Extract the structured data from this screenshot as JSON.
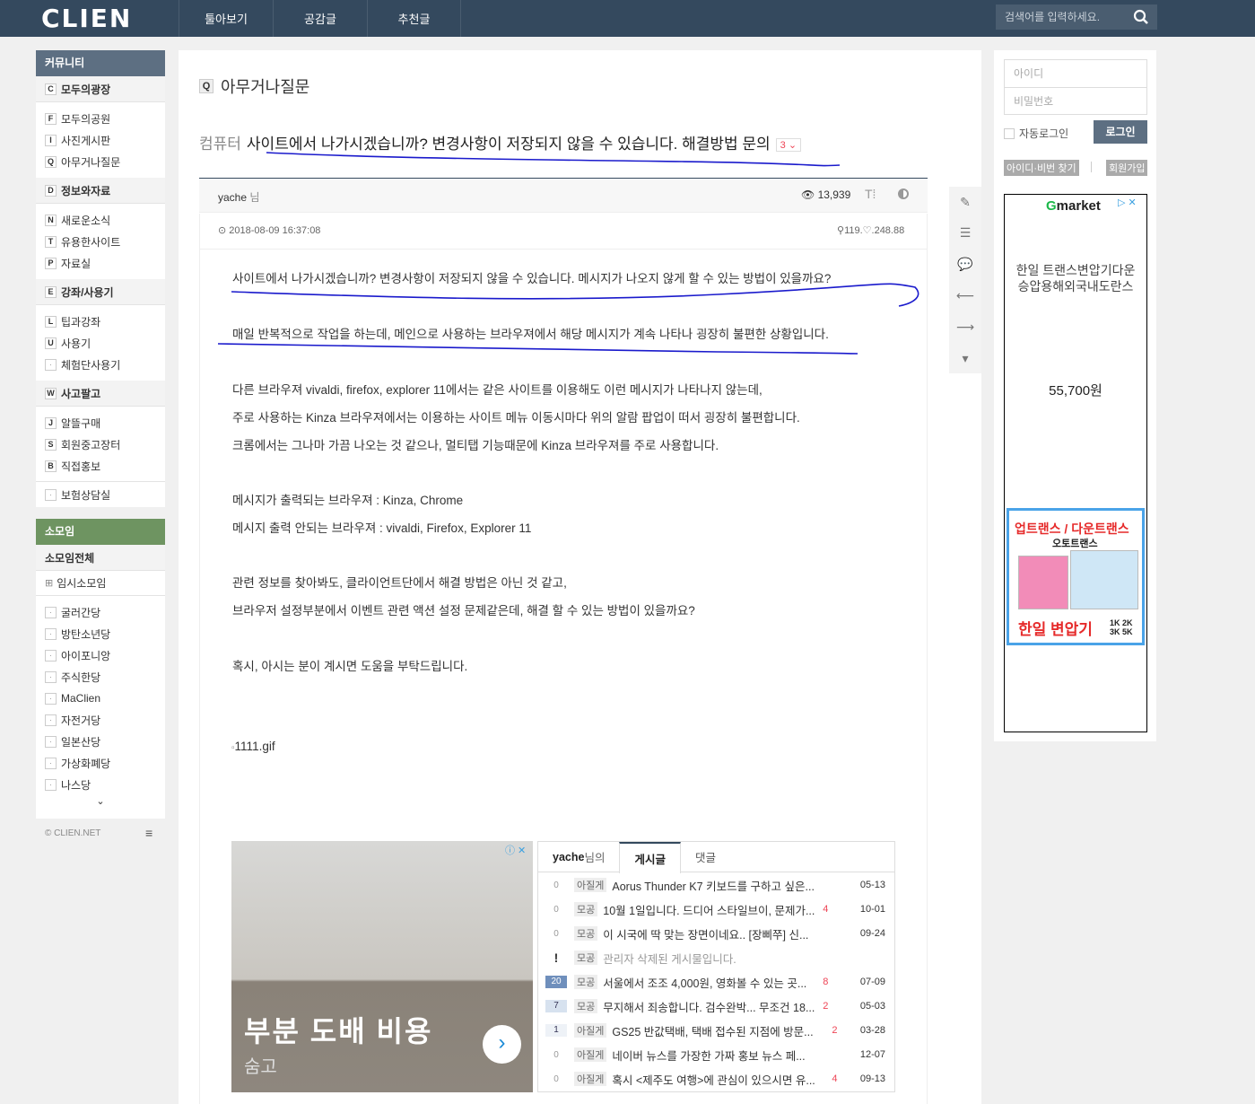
{
  "header": {
    "logo": "CLIEN",
    "nav": [
      "툴아보기",
      "공감글",
      "추천글"
    ],
    "search_placeholder": "검색어를 입력하세요."
  },
  "sidebar": {
    "community_title": "커뮤니티",
    "groups": [
      {
        "badge": "C",
        "label": "모두의광장",
        "items": [
          {
            "badge": "F",
            "label": "모두의공원"
          },
          {
            "badge": "I",
            "label": "사진게시판"
          },
          {
            "badge": "Q",
            "label": "아무거나질문"
          }
        ]
      },
      {
        "badge": "D",
        "label": "정보와자료",
        "items": [
          {
            "badge": "N",
            "label": "새로운소식"
          },
          {
            "badge": "T",
            "label": "유용한사이트"
          },
          {
            "badge": "P",
            "label": "자료실"
          }
        ]
      },
      {
        "badge": "E",
        "label": "강좌/사용기",
        "items": [
          {
            "badge": "L",
            "label": "팁과강좌"
          },
          {
            "badge": "U",
            "label": "사용기"
          },
          {
            "badge": "·",
            "label": "체험단사용기"
          }
        ]
      },
      {
        "badge": "W",
        "label": "사고팔고",
        "items": [
          {
            "badge": "J",
            "label": "알뜰구매"
          },
          {
            "badge": "S",
            "label": "회원중고장터"
          },
          {
            "badge": "B",
            "label": "직접홍보"
          }
        ]
      }
    ],
    "insurance": "보험상담실",
    "somoim_title": "소모임",
    "somoim_all": "소모임전체",
    "temp_somoim": "임시소모임",
    "somoim_items": [
      "굴러간당",
      "방탄소년당",
      "아이포니앙",
      "주식한당",
      "MaClien",
      "자전거당",
      "일본산당",
      "가상화폐당",
      "나스당"
    ],
    "footer": "© CLIEN.NET"
  },
  "board": {
    "badge": "Q",
    "title": "아무거나질문"
  },
  "post": {
    "category": "컴퓨터",
    "title": "사이트에서 나가시겠습니까? 변경사항이 저장되지 않을 수 있습니다. 해결방법 문의",
    "comment_count": "3",
    "author": "yache",
    "author_suffix": " 님",
    "views": "13,939",
    "font_tool": "T⁞",
    "date": "2018-08-09 16:37:08",
    "ip": "119.♡.248.88",
    "paragraphs": [
      "사이트에서 나가시겠습니까? 변경사항이 저장되지 않을 수 있습니다. 메시지가 나오지 않게 할 수 있는 방법이 있을까요?",
      "매일 반복적으로 작업을 하는데, 메인으로 사용하는 브라우져에서 해당 메시지가 계속 나타나 굉장히 불편한 상황입니다.",
      "다른 브라우져 vivaldi, firefox, explorer 11에서는 같은 사이트를 이용해도 이런 메시지가 나타나지 않는데,",
      "주로 사용하는 Kinza 브라우져에서는 이용하는 사이트 메뉴 이동시마다 위의 알람 팝업이 떠서 굉장히 불편합니다.",
      "크롬에서는 그나마 가끔 나오는 것 같으나, 멀티탭 기능때문에 Kinza 브라우져를 주로 사용합니다.",
      "메시지가 출력되는 브라우져 : Kinza, Chrome",
      "메시지 출력 안되는 브라우져 : vivaldi, Firefox, Explorer 11",
      "관련 정보를 찾아봐도, 클라이언트단에서 해결 방법은 아닌 것 같고,",
      "브라우저 설정부분에서 이벤트 관련 액션 설정 문제같은데, 해결 할 수 있는 방법이 있을까요?",
      "혹시, 아시는 분이 계시면 도움을 부탁드립니다."
    ],
    "image_alt": "1111.gif"
  },
  "ad_left": {
    "headline": "부분 도배 비용",
    "brand": "숨고"
  },
  "user_posts": {
    "user": "yache",
    "user_suffix": " 님의",
    "tabs": [
      "게시글",
      "댓글"
    ],
    "rows": [
      {
        "num": "0",
        "tag": "아질게",
        "title": "Aorus Thunder K7 키보드를 구하고 싶은...",
        "comments": "",
        "date": "05-13"
      },
      {
        "num": "0",
        "tag": "모공",
        "title": "10월 1일입니다. 드디어 스타일브이, 문제가...",
        "comments": "4",
        "date": "10-01"
      },
      {
        "num": "0",
        "tag": "모공",
        "title": "이 시국에 딱 맞는 장면이네요.. [장삐쭈] 신...",
        "comments": "",
        "date": "09-24"
      },
      {
        "num": "!",
        "tag": "모공",
        "title": "관리자 삭제된 게시물입니다.",
        "comments": "",
        "date": ""
      },
      {
        "num": "20",
        "tag": "모공",
        "title": "서울에서 조조 4,000원, 영화볼 수 있는 곳...",
        "comments": "8",
        "date": "07-09"
      },
      {
        "num": "7",
        "tag": "모공",
        "title": "무지해서 죄송합니다. 검수완박... 무조건 18...",
        "comments": "2",
        "date": "05-03"
      },
      {
        "num": "1",
        "tag": "아질게",
        "title": "GS25 반값택배, 택배 접수된 지점에 방문...",
        "comments": "2",
        "date": "03-28"
      },
      {
        "num": "0",
        "tag": "아질게",
        "title": "네이버 뉴스를 가장한 가짜 홍보 뉴스 페...",
        "comments": "",
        "date": "12-07"
      },
      {
        "num": "0",
        "tag": "아질게",
        "title": "혹시 <제주도 여행>에 관심이 있으시면 유...",
        "comments": "4",
        "date": "09-13"
      }
    ]
  },
  "login": {
    "id_placeholder": "아이디",
    "pw_placeholder": "비밀번호",
    "auto_login": "자동로그인",
    "login_button": "로그인",
    "find": "아이디·비번 찾기",
    "join": "회원가입"
  },
  "ad_right": {
    "brand_g": "G",
    "brand_rest": "market",
    "text": "한일 트랜스변압기다운승압용해외국내도란스",
    "price": "55,700원",
    "img_t1": "업트랜스 / 다운트랜스",
    "img_t2": "오토트랜스",
    "img_t3": "한일 변압기",
    "img_t4": "1K 2K 3K 5K"
  },
  "colors": {
    "topbar": "#34495e",
    "annotation_ink": "#1a1acc",
    "accent_red": "#e44455"
  }
}
